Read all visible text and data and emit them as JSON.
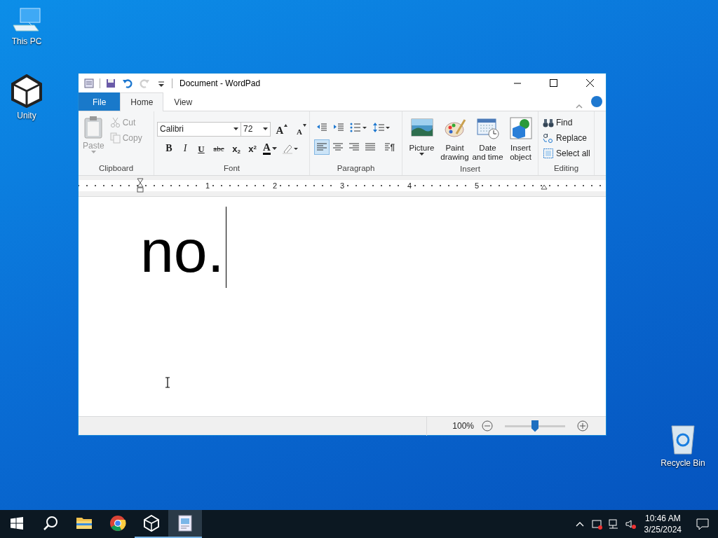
{
  "desktop_icons": [
    {
      "label": "This PC",
      "kind": "pc"
    },
    {
      "label": "Unity",
      "kind": "unity"
    },
    {
      "label": "Recycle Bin",
      "kind": "bin"
    }
  ],
  "window": {
    "title": "Document - WordPad",
    "quick_access": [
      {
        "kind": "app",
        "disabled": false
      },
      {
        "kind": "save",
        "disabled": false
      },
      {
        "kind": "undo",
        "disabled": false
      },
      {
        "kind": "redo",
        "disabled": true
      },
      {
        "kind": "customize",
        "disabled": false
      }
    ],
    "tabs": [
      {
        "label": "File",
        "kind": "file",
        "selected": false
      },
      {
        "label": "Home",
        "kind": "tab",
        "selected": true
      },
      {
        "label": "View",
        "kind": "tab",
        "selected": false
      }
    ],
    "clipboard": {
      "label": "Clipboard",
      "paste": {
        "label": "Paste",
        "disabled": true
      },
      "items": [
        {
          "label": "Cut",
          "kind": "cut",
          "disabled": true
        },
        {
          "label": "Copy",
          "kind": "copy",
          "disabled": true
        }
      ]
    },
    "font": {
      "label": "Font",
      "font_name": "Calibri",
      "font_size": "72",
      "size_buttons": [
        {
          "kind": "grow",
          "glyph": "A"
        },
        {
          "kind": "shrink",
          "glyph": "A"
        }
      ],
      "format_buttons": [
        {
          "kind": "bold",
          "glyph": "B"
        },
        {
          "kind": "italic",
          "glyph": "I"
        },
        {
          "kind": "underline",
          "glyph": "U"
        },
        {
          "kind": "strike",
          "glyph": "abc"
        },
        {
          "kind": "subscript",
          "glyph": "x$_{2}$"
        },
        {
          "kind": "superscript",
          "glyph": "x$^{2}$"
        },
        {
          "kind": "color",
          "glyph": "A"
        },
        {
          "kind": "highlight"
        }
      ]
    },
    "paragraph": {
      "label": "Paragraph",
      "list_buttons": [
        {
          "kind": "outdent"
        },
        {
          "kind": "indent"
        },
        {
          "kind": "bullets"
        },
        {
          "kind": "spacing"
        }
      ],
      "alignment": [
        {
          "kind": "left",
          "selected": true
        },
        {
          "kind": "center",
          "selected": false
        },
        {
          "kind": "right",
          "selected": false
        },
        {
          "kind": "justify",
          "selected": false
        }
      ],
      "extra_buttons": [
        {
          "kind": "paragraph"
        }
      ]
    },
    "insert": {
      "label": "Insert",
      "items": [
        {
          "label": "Picture",
          "kind": "picture",
          "dropdown": true
        },
        {
          "label": "Paint drawing",
          "kind": "paint",
          "dropdown": false
        },
        {
          "label": "Date and time",
          "kind": "datetime",
          "dropdown": false
        },
        {
          "label": "Insert object",
          "kind": "object",
          "dropdown": false
        }
      ]
    },
    "editing": {
      "label": "Editing",
      "items": [
        {
          "label": "Find",
          "kind": "find"
        },
        {
          "label": "Replace",
          "kind": "replace"
        },
        {
          "label": "Select all",
          "kind": "selectall"
        }
      ]
    },
    "ruler": {
      "numbers": [
        "1",
        "2",
        "3",
        "4",
        "5"
      ]
    },
    "document": {
      "text": "no."
    },
    "status_bar": {
      "zoom": "100%",
      "zoom_slider": {
        "level": 0.5
      }
    }
  },
  "taskbar": {
    "apps": [
      {
        "kind": "explorer",
        "running": false,
        "active": false
      },
      {
        "kind": "chrome",
        "running": false,
        "active": false
      },
      {
        "kind": "unity",
        "running": true,
        "active": false
      },
      {
        "kind": "wordpad",
        "running": true,
        "active": true
      }
    ],
    "time": "10:46 AM",
    "date": "3/25/2024"
  }
}
